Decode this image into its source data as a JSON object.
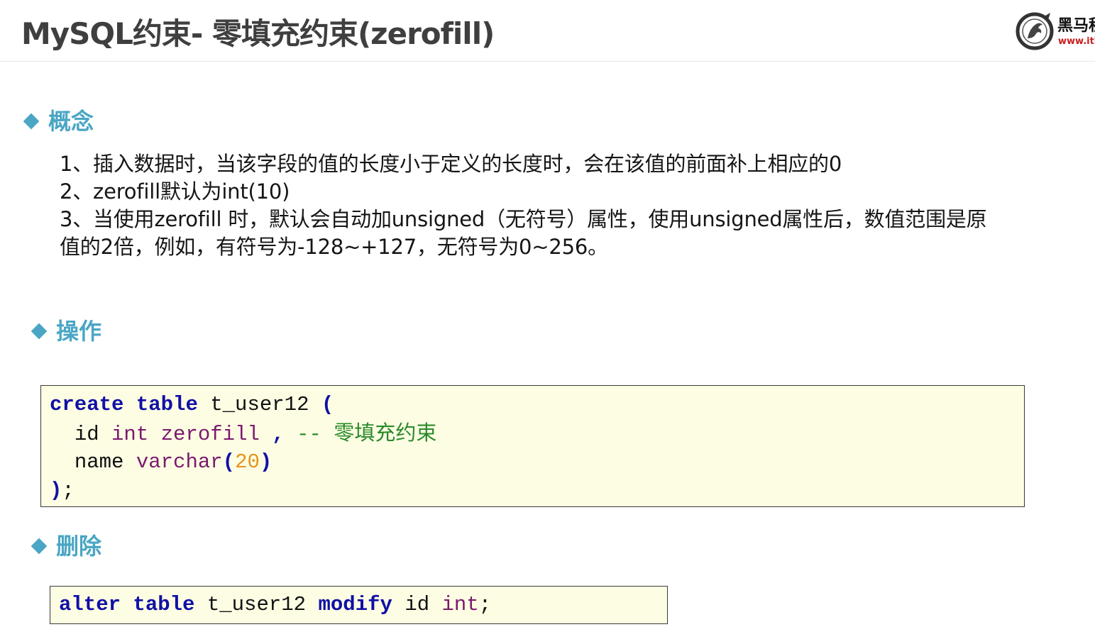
{
  "header": {
    "title": "MySQL约束- 零填充约束(zerofill)",
    "logo": {
      "icon": "horse-logo-icon",
      "text_cn": "黑马程",
      "url": "www.ithe"
    }
  },
  "colors": {
    "accent": "#4aa6c4",
    "title": "#3f3f3f",
    "code_background": "#fdfde3",
    "keyword": "#1010a6",
    "type": "#7a1a6e",
    "number": "#e6941a",
    "comment": "#2a8a2a",
    "logo_url": "#c81d1d"
  },
  "sections": {
    "concept": {
      "label": "概念",
      "icon": "diamond-bullet-icon",
      "lines": [
        "1、插入数据时，当该字段的值的长度小于定义的长度时，会在该值的前面补上相应的0",
        "2、zerofill默认为int(10)",
        "3、当使用zerofill 时，默认会自动加unsigned（无符号）属性，使用unsigned属性后，数值范围是原",
        "值的2倍，例如，有符号为-128~+127，无符号为0~256。"
      ]
    },
    "operation": {
      "label": "操作",
      "icon": "diamond-bullet-icon",
      "code": {
        "line1": {
          "kw1": "create",
          "kw2": "table",
          "name": "t_user12",
          "paren": "("
        },
        "line2": {
          "col": "id",
          "type": "int",
          "attr": "zerofill",
          "comma": ",",
          "comment_dash": "--",
          "comment_text": "零填充约束"
        },
        "line3": {
          "col": "name",
          "type": "varchar",
          "open": "(",
          "len": "20",
          "close": ")"
        },
        "line4": {
          "close": ")",
          "semi": ";"
        }
      }
    },
    "delete": {
      "label": "删除",
      "icon": "diamond-bullet-icon",
      "code": {
        "kw1": "alter",
        "kw2": "table",
        "name": "t_user12",
        "kw3": "modify",
        "col": "id",
        "type": "int",
        "semi": ";"
      }
    }
  }
}
